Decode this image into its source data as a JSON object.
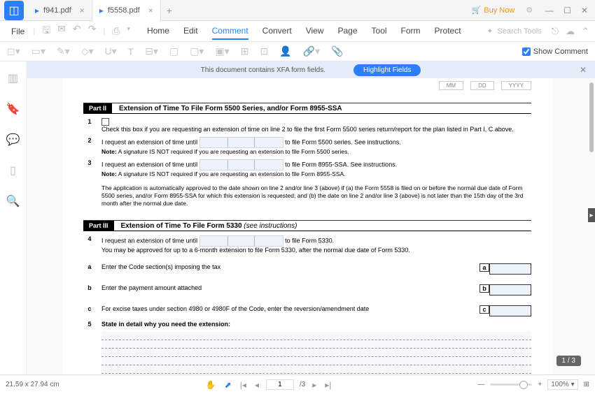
{
  "tabs": [
    {
      "name": "f941.pdf"
    },
    {
      "name": "f5558.pdf"
    }
  ],
  "titlebar": {
    "buy_now": "Buy Now"
  },
  "menubar": {
    "file": "File",
    "tabs": {
      "home": "Home",
      "edit": "Edit",
      "comment": "Comment",
      "convert": "Convert",
      "view": "View",
      "page": "Page",
      "tool": "Tool",
      "form": "Form",
      "protect": "Protect"
    },
    "search_placeholder": "Search Tools"
  },
  "toolbar": {
    "show_comment": "Show Comment"
  },
  "xfa": {
    "msg": "This document contains XFA form fields.",
    "highlight": "Highlight Fields"
  },
  "page_indicator": "1 / 3",
  "statusbar": {
    "dimensions": "21.59 x 27.94 cm",
    "page_value": "1",
    "page_total": "/3",
    "zoom": "100%"
  },
  "doc": {
    "header_boxes": [
      "MM",
      "DD",
      "YYYY"
    ],
    "part2": {
      "label": "Part II",
      "title": "Extension of Time To File Form 5500 Series, and/or Form 8955-SSA",
      "line1_num": "1",
      "line1_text": "Check this box if you are requesting an extension of time on line 2 to file the first Form 5500 series return/report for the plan listed in Part I, C above.",
      "line2_num": "2",
      "line2_a": "I request an extension of time until",
      "line2_b": "to file Form 5500 series. See instructions.",
      "line2_note_label": "Note:",
      "line2_note": " A signature IS NOT required if you are requesting an extension to file Form 5500 series.",
      "line3_num": "3",
      "line3_a": "I request an extension of time until",
      "line3_b": "to file Form 8955-SSA. See instructions.",
      "line3_note_label": "Note:",
      "line3_note": " A signature IS NOT required if you are requesting an extension to file Form 8955-SSA.",
      "para": "The application is automatically approved to the date shown on line 2 and/or line 3 (above) if (a) the Form 5558 is filed on or before the normal due date of Form 5500 series, and/or Form 8955-SSA for which this extension is requested; and (b) the date on line 2 and/or line 3 (above) is not later than the 15th day of the 3rd month after the normal due date."
    },
    "part3": {
      "label": "Part III",
      "title": "Extension of Time To File Form 5330 ",
      "title_em": "(see instructions)",
      "line4_num": "4",
      "line4_a": "I request an extension of time until",
      "line4_b": "to file Form 5330.",
      "line4_sub": "You may be approved for up to a 6-month extension to file Form 5330, after the normal due date of Form 5330.",
      "linea_letter": "a",
      "linea_text": "Enter the Code section(s) imposing the tax",
      "linea_box_label": "a",
      "lineb_letter": "b",
      "lineb_text": "Enter the payment amount attached",
      "lineb_box_label": "b",
      "linec_letter": "c",
      "linec_text": "For excise taxes under section 4980 or 4980F of the Code, enter the reversion/amendment date",
      "linec_box_label": "c",
      "line5_num": "5",
      "line5_text": "State in detail why you need the extension:"
    }
  }
}
